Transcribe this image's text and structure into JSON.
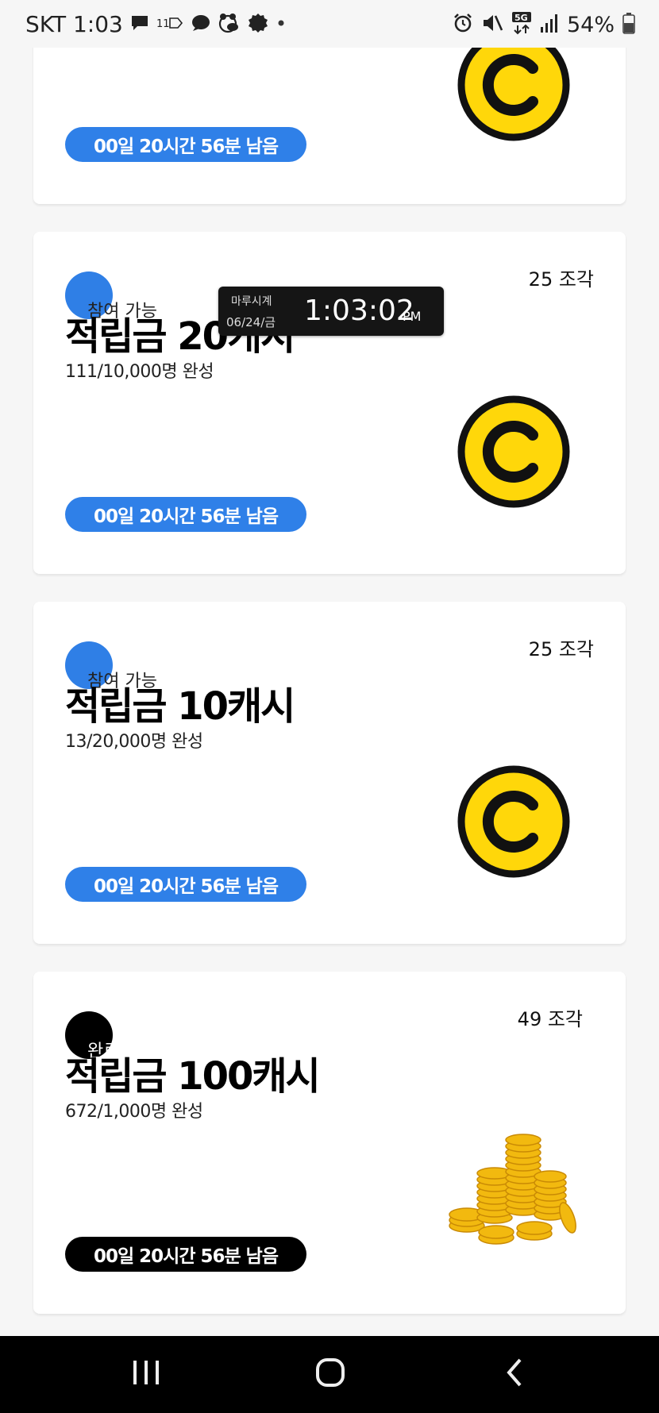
{
  "status_bar": {
    "carrier_time": "SKT 1:03",
    "network_type": "5G",
    "battery_percent": "54%",
    "left_icons": [
      "message-icon",
      "11st-app-icon",
      "chat-bubble-icon",
      "bug-app-icon",
      "settings-badge-icon",
      "more-dot-icon"
    ],
    "right_icons": [
      "alarm-icon",
      "mute-icon",
      "5g-icon",
      "signal-icon",
      "battery-icon"
    ]
  },
  "clock_widget": {
    "name": "마루시계",
    "date": "06/24/금",
    "time": "1:03:02",
    "ampm": "PM"
  },
  "cards": [
    {
      "countdown": "00일 20시간 56분 남음",
      "countdown_color": "#2f80e8",
      "image": "coin-icon"
    },
    {
      "status": "참여 가능",
      "pieces": "25 조각",
      "title": "적립금 20캐시",
      "progress": "111/10,000명 완성",
      "countdown": "00일 20시간 56분 남음",
      "countdown_color": "#2f80e8",
      "image": "coin-icon"
    },
    {
      "status": "참여 가능",
      "pieces": "25 조각",
      "title": "적립금 10캐시",
      "progress": "13/20,000명 완성",
      "countdown": "00일 20시간 56분 남음",
      "countdown_color": "#2f80e8",
      "image": "coin-icon"
    },
    {
      "status": "완료",
      "pieces": "49 조각",
      "title": "적립금 100캐시",
      "progress": "672/1,000명 완성",
      "countdown": "00일 20시간 56분 남음",
      "countdown_color": "#000000",
      "image": "gold-coins-stack-icon"
    }
  ],
  "colors": {
    "accent_blue": "#2f80e8",
    "coin_yellow": "#ffd70a",
    "background": "#f6f6f6"
  },
  "nav_bar": {
    "buttons": [
      "recent-apps-icon",
      "home-icon",
      "back-icon"
    ]
  }
}
